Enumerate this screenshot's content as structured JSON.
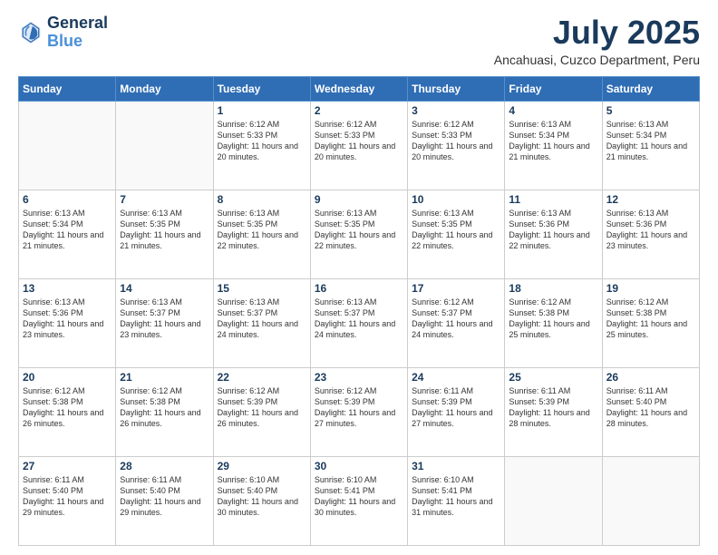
{
  "logo": {
    "line1": "General",
    "line2": "Blue"
  },
  "title": "July 2025",
  "subtitle": "Ancahuasi, Cuzco Department, Peru",
  "weekdays": [
    "Sunday",
    "Monday",
    "Tuesday",
    "Wednesday",
    "Thursday",
    "Friday",
    "Saturday"
  ],
  "weeks": [
    [
      {
        "day": "",
        "info": ""
      },
      {
        "day": "",
        "info": ""
      },
      {
        "day": "1",
        "info": "Sunrise: 6:12 AM\nSunset: 5:33 PM\nDaylight: 11 hours\nand 20 minutes."
      },
      {
        "day": "2",
        "info": "Sunrise: 6:12 AM\nSunset: 5:33 PM\nDaylight: 11 hours\nand 20 minutes."
      },
      {
        "day": "3",
        "info": "Sunrise: 6:12 AM\nSunset: 5:33 PM\nDaylight: 11 hours\nand 20 minutes."
      },
      {
        "day": "4",
        "info": "Sunrise: 6:13 AM\nSunset: 5:34 PM\nDaylight: 11 hours\nand 21 minutes."
      },
      {
        "day": "5",
        "info": "Sunrise: 6:13 AM\nSunset: 5:34 PM\nDaylight: 11 hours\nand 21 minutes."
      }
    ],
    [
      {
        "day": "6",
        "info": "Sunrise: 6:13 AM\nSunset: 5:34 PM\nDaylight: 11 hours\nand 21 minutes."
      },
      {
        "day": "7",
        "info": "Sunrise: 6:13 AM\nSunset: 5:35 PM\nDaylight: 11 hours\nand 21 minutes."
      },
      {
        "day": "8",
        "info": "Sunrise: 6:13 AM\nSunset: 5:35 PM\nDaylight: 11 hours\nand 22 minutes."
      },
      {
        "day": "9",
        "info": "Sunrise: 6:13 AM\nSunset: 5:35 PM\nDaylight: 11 hours\nand 22 minutes."
      },
      {
        "day": "10",
        "info": "Sunrise: 6:13 AM\nSunset: 5:35 PM\nDaylight: 11 hours\nand 22 minutes."
      },
      {
        "day": "11",
        "info": "Sunrise: 6:13 AM\nSunset: 5:36 PM\nDaylight: 11 hours\nand 22 minutes."
      },
      {
        "day": "12",
        "info": "Sunrise: 6:13 AM\nSunset: 5:36 PM\nDaylight: 11 hours\nand 23 minutes."
      }
    ],
    [
      {
        "day": "13",
        "info": "Sunrise: 6:13 AM\nSunset: 5:36 PM\nDaylight: 11 hours\nand 23 minutes."
      },
      {
        "day": "14",
        "info": "Sunrise: 6:13 AM\nSunset: 5:37 PM\nDaylight: 11 hours\nand 23 minutes."
      },
      {
        "day": "15",
        "info": "Sunrise: 6:13 AM\nSunset: 5:37 PM\nDaylight: 11 hours\nand 24 minutes."
      },
      {
        "day": "16",
        "info": "Sunrise: 6:13 AM\nSunset: 5:37 PM\nDaylight: 11 hours\nand 24 minutes."
      },
      {
        "day": "17",
        "info": "Sunrise: 6:12 AM\nSunset: 5:37 PM\nDaylight: 11 hours\nand 24 minutes."
      },
      {
        "day": "18",
        "info": "Sunrise: 6:12 AM\nSunset: 5:38 PM\nDaylight: 11 hours\nand 25 minutes."
      },
      {
        "day": "19",
        "info": "Sunrise: 6:12 AM\nSunset: 5:38 PM\nDaylight: 11 hours\nand 25 minutes."
      }
    ],
    [
      {
        "day": "20",
        "info": "Sunrise: 6:12 AM\nSunset: 5:38 PM\nDaylight: 11 hours\nand 26 minutes."
      },
      {
        "day": "21",
        "info": "Sunrise: 6:12 AM\nSunset: 5:38 PM\nDaylight: 11 hours\nand 26 minutes."
      },
      {
        "day": "22",
        "info": "Sunrise: 6:12 AM\nSunset: 5:39 PM\nDaylight: 11 hours\nand 26 minutes."
      },
      {
        "day": "23",
        "info": "Sunrise: 6:12 AM\nSunset: 5:39 PM\nDaylight: 11 hours\nand 27 minutes."
      },
      {
        "day": "24",
        "info": "Sunrise: 6:11 AM\nSunset: 5:39 PM\nDaylight: 11 hours\nand 27 minutes."
      },
      {
        "day": "25",
        "info": "Sunrise: 6:11 AM\nSunset: 5:39 PM\nDaylight: 11 hours\nand 28 minutes."
      },
      {
        "day": "26",
        "info": "Sunrise: 6:11 AM\nSunset: 5:40 PM\nDaylight: 11 hours\nand 28 minutes."
      }
    ],
    [
      {
        "day": "27",
        "info": "Sunrise: 6:11 AM\nSunset: 5:40 PM\nDaylight: 11 hours\nand 29 minutes."
      },
      {
        "day": "28",
        "info": "Sunrise: 6:11 AM\nSunset: 5:40 PM\nDaylight: 11 hours\nand 29 minutes."
      },
      {
        "day": "29",
        "info": "Sunrise: 6:10 AM\nSunset: 5:40 PM\nDaylight: 11 hours\nand 30 minutes."
      },
      {
        "day": "30",
        "info": "Sunrise: 6:10 AM\nSunset: 5:41 PM\nDaylight: 11 hours\nand 30 minutes."
      },
      {
        "day": "31",
        "info": "Sunrise: 6:10 AM\nSunset: 5:41 PM\nDaylight: 11 hours\nand 31 minutes."
      },
      {
        "day": "",
        "info": ""
      },
      {
        "day": "",
        "info": ""
      }
    ]
  ]
}
